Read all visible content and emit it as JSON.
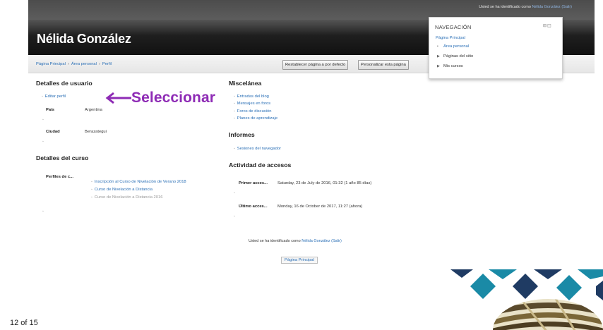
{
  "header": {
    "login_text": "Usted se ha identificado como ",
    "login_user": "Nélida González",
    "login_logout": " (Salir)",
    "user_name": "Nélida González"
  },
  "breadcrumb": {
    "items": [
      "Página Principal",
      "Área personal",
      "Perfil"
    ],
    "separator": "›"
  },
  "buttons": {
    "reset_label": "Restablecer página a por defecto",
    "customize_label": "Personalizar esta página"
  },
  "navigation": {
    "title": "NAVEGACIÓN",
    "home": "Página Principal",
    "items": [
      {
        "label": "Área personal"
      },
      {
        "label": "Páginas del sitio"
      },
      {
        "label": "Mis cursos"
      }
    ]
  },
  "user_details": {
    "heading": "Detalles de usuario",
    "edit_link": "Editar perfil",
    "country_label": "País",
    "country_value": "Argentina",
    "city_label": "Ciudad",
    "city_value": "Berazategui"
  },
  "course_details": {
    "heading": "Detalles del curso",
    "profiles_label": "Perfiles de c...",
    "courses": [
      {
        "name": "Inscripción al Curso de Nivelación de Verano 2018"
      },
      {
        "name": "Curso de Nivelación a Distancia"
      },
      {
        "name": "Curso de Nivelación a Distancia 2016"
      }
    ]
  },
  "misc": {
    "heading": "Miscelánea",
    "links": [
      "Entradas del blog",
      "Mensajes en foros",
      "Foros de discusión",
      "Planes de aprendizaje"
    ]
  },
  "reports": {
    "heading": "Informes",
    "links": [
      "Sesiones del navegador"
    ]
  },
  "access": {
    "heading": "Actividad de accesos",
    "first_label": "Primer acces...",
    "first_value": "Saturday, 23 de July de 2016, 01:32  (1 año 85 días)",
    "last_label": "Último acces...",
    "last_value": "Monday, 16 de October de 2017, 11:27  (ahora)"
  },
  "footer": {
    "login_text": "Usted se ha identificado como ",
    "login_user": "Nélida González",
    "login_logout": " (Salir)",
    "home_button": "Página Principal"
  },
  "annotation": {
    "text": "Seleccionar",
    "color": "#8e2bb5"
  },
  "slide": {
    "number_text": "12 of 15"
  },
  "colors": {
    "link": "#2a6fb6",
    "banner": "#1f1f1f",
    "logo_dark": "#1f3b63",
    "logo_teal": "#1a8aa6"
  }
}
